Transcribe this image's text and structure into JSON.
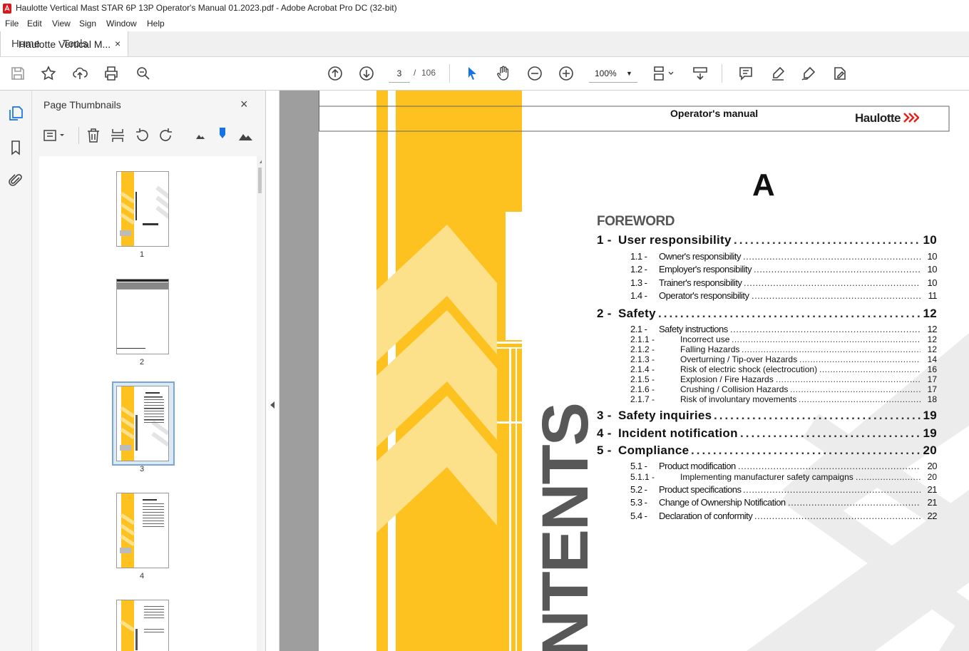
{
  "window": {
    "title": "Haulotte Vertical Mast STAR 6P 13P Operator's Manual 01.2023.pdf - Adobe Acrobat Pro DC (32-bit)"
  },
  "menu": [
    "File",
    "Edit",
    "View",
    "Sign",
    "Window",
    "Help"
  ],
  "tabs": {
    "home": "Home",
    "tools": "Tools",
    "document": "Haulotte Vertical M...",
    "close": "×"
  },
  "toolbar": {
    "page_current": "3",
    "page_separator": "/",
    "page_total": "106",
    "zoom": "100%",
    "zoom_caret": "▼",
    "icons": [
      "save-icon",
      "star-icon",
      "upload-icon",
      "print-icon",
      "zoom-search-icon",
      "page-up-icon",
      "page-down-icon",
      "select-cursor-icon",
      "hand-icon",
      "zoom-out-icon",
      "zoom-in-icon",
      "page-layout-icon",
      "scroll-mode-icon",
      "comment-icon",
      "highlight-icon",
      "sign-icon",
      "fill-sign-icon"
    ]
  },
  "sidebar": {
    "icons": [
      "page-thumbnails-icon",
      "bookmark-icon",
      "attachment-icon"
    ]
  },
  "panel": {
    "title": "Page Thumbnails",
    "close": "×",
    "thumbnails": [
      {
        "label": "1"
      },
      {
        "label": "2"
      },
      {
        "label": "3",
        "selected": true
      },
      {
        "label": "4"
      },
      {
        "label": ""
      }
    ]
  },
  "document": {
    "header": "Operator's manual",
    "brand": "Haulotte",
    "section_letter": "A",
    "vertical_text": "NTENTS",
    "foreword": "FOREWORD",
    "toc": [
      {
        "level": 1,
        "num": "1 -",
        "title": "User responsibility",
        "page": "10"
      },
      {
        "level": 2,
        "num": "1.1 -",
        "title": "Owner's responsibility",
        "page": "10"
      },
      {
        "level": 2,
        "num": "1.2 -",
        "title": "Employer's responsibility",
        "page": "10"
      },
      {
        "level": 2,
        "num": "1.3 -",
        "title": "Trainer's responsibility",
        "page": "10"
      },
      {
        "level": 2,
        "num": "1.4 -",
        "title": "Operator's responsibility",
        "page": "11"
      },
      {
        "level": 1,
        "num": "2 -",
        "title": "Safety",
        "page": "12"
      },
      {
        "level": 2,
        "num": "2.1 -",
        "title": "Safety instructions",
        "page": "12"
      },
      {
        "level": 3,
        "num": "2.1.1 -",
        "title": "Incorrect use",
        "page": "12"
      },
      {
        "level": 3,
        "num": "2.1.2 -",
        "title": "Falling Hazards",
        "page": "12"
      },
      {
        "level": 3,
        "num": "2.1.3 -",
        "title": "Overturning / Tip-over Hazards",
        "page": "14"
      },
      {
        "level": 3,
        "num": "2.1.4 -",
        "title": "Risk of electric shock (electrocution)",
        "page": "16"
      },
      {
        "level": 3,
        "num": "2.1.5 -",
        "title": "Explosion / Fire Hazards",
        "page": "17"
      },
      {
        "level": 3,
        "num": "2.1.6 -",
        "title": "Crushing / Collision Hazards",
        "page": "17"
      },
      {
        "level": 3,
        "num": "2.1.7 -",
        "title": "Risk of involuntary movements",
        "page": "18"
      },
      {
        "level": 1,
        "num": "3 -",
        "title": "Safety inquiries",
        "page": "19"
      },
      {
        "level": 1,
        "num": "4 -",
        "title": "Incident notification",
        "page": "19"
      },
      {
        "level": 1,
        "num": "5 -",
        "title": "Compliance",
        "page": "20"
      },
      {
        "level": 2,
        "num": "5.1 -",
        "title": "Product modification",
        "page": "20"
      },
      {
        "level": 3,
        "num": "5.1.1 -",
        "title": "Implementing manufacturer safety campaigns",
        "page": "20"
      },
      {
        "level": 2,
        "num": "5.2 -",
        "title": "Product specifications",
        "page": "21"
      },
      {
        "level": 2,
        "num": "5.3 -",
        "title": "Change of Ownership Notification",
        "page": "21"
      },
      {
        "level": 2,
        "num": "5.4 -",
        "title": "Declaration of conformity",
        "page": "22"
      }
    ]
  },
  "colors": {
    "accent_yellow": "#fdc220",
    "light_yellow": "#fde08a",
    "chevron_gray": "#ececec",
    "brand_red": "#e32119"
  }
}
